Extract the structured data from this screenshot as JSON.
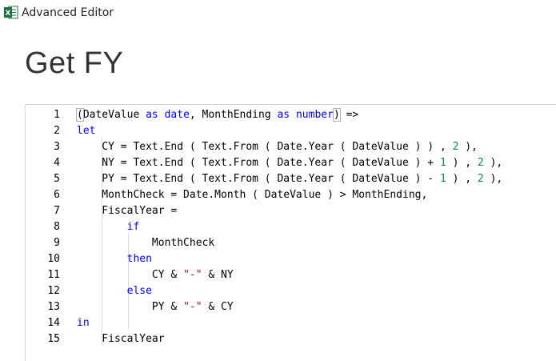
{
  "window": {
    "title": "Advanced Editor",
    "icon": "excel-icon",
    "brand_color": "#1d6f42"
  },
  "query": {
    "name": "Get FY"
  },
  "editor": {
    "lines": [
      {
        "n": "1",
        "tokens": [
          [
            "(",
            "cursor-box"
          ],
          [
            "DateValue ",
            ""
          ],
          [
            "as",
            "kw"
          ],
          [
            " ",
            ""
          ],
          [
            "date",
            "kw"
          ],
          [
            ", MonthEnding ",
            ""
          ],
          [
            "as",
            "kw"
          ],
          [
            " ",
            ""
          ],
          [
            "number",
            "kw"
          ],
          [
            ")",
            "cursor-box"
          ],
          [
            " =>",
            ""
          ]
        ]
      },
      {
        "n": "2",
        "tokens": [
          [
            "let",
            "kw"
          ]
        ]
      },
      {
        "n": "3",
        "tokens": [
          [
            "    CY = Text.End ( Text.From ( Date.Year ( DateValue ) ) , ",
            ""
          ],
          [
            "2",
            "num"
          ],
          [
            " ),",
            ""
          ]
        ]
      },
      {
        "n": "4",
        "tokens": [
          [
            "    NY = Text.End ( Text.From ( Date.Year ( DateValue ) + ",
            ""
          ],
          [
            "1",
            "num"
          ],
          [
            " ) , ",
            ""
          ],
          [
            "2",
            "num"
          ],
          [
            " ),",
            ""
          ]
        ]
      },
      {
        "n": "5",
        "tokens": [
          [
            "    PY = Text.End ( Text.From ( Date.Year ( DateValue ) - ",
            ""
          ],
          [
            "1",
            "num"
          ],
          [
            " ) , ",
            ""
          ],
          [
            "2",
            "num"
          ],
          [
            " ),",
            ""
          ]
        ]
      },
      {
        "n": "6",
        "tokens": [
          [
            "    MonthCheck = Date.Month ( DateValue ) > MonthEnding,",
            ""
          ]
        ]
      },
      {
        "n": "7",
        "tokens": [
          [
            "    FiscalYear =",
            ""
          ]
        ]
      },
      {
        "n": "8",
        "tokens": [
          [
            "        ",
            ""
          ],
          [
            "if",
            "kw"
          ]
        ]
      },
      {
        "n": "9",
        "tokens": [
          [
            "            MonthCheck",
            ""
          ]
        ]
      },
      {
        "n": "10",
        "tokens": [
          [
            "        ",
            ""
          ],
          [
            "then",
            "kw"
          ]
        ]
      },
      {
        "n": "11",
        "tokens": [
          [
            "            CY & ",
            ""
          ],
          [
            "\"-\"",
            "str"
          ],
          [
            " & NY",
            ""
          ]
        ]
      },
      {
        "n": "12",
        "tokens": [
          [
            "        ",
            ""
          ],
          [
            "else",
            "kw"
          ]
        ]
      },
      {
        "n": "13",
        "tokens": [
          [
            "            PY & ",
            ""
          ],
          [
            "\"-\"",
            "str"
          ],
          [
            " & CY",
            ""
          ]
        ]
      },
      {
        "n": "14",
        "tokens": [
          [
            "in",
            "kw"
          ]
        ]
      },
      {
        "n": "15",
        "tokens": [
          [
            "    FiscalYear",
            ""
          ]
        ]
      }
    ]
  }
}
